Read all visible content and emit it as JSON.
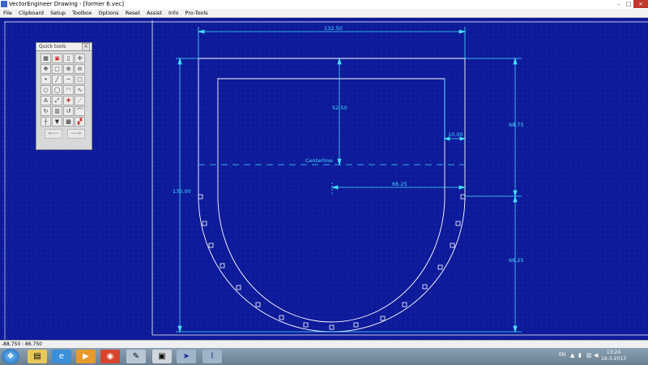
{
  "window": {
    "title": "VectorEngineer Drawing - [former 6.vec]",
    "min_label": "–",
    "max_label": "□",
    "close_label": "×"
  },
  "menu": [
    "File",
    "Clipboard",
    "Setup",
    "Toolbox",
    "Options",
    "Reset",
    "Assist",
    "Info",
    "Pro-Tools"
  ],
  "quick_tools": {
    "title": "Quick tools",
    "close_label": "×",
    "tools": [
      "grid-icon",
      "layers-icon",
      "new-page-icon",
      "snap-icon",
      "move-icon",
      "image-icon",
      "zoom-in-icon",
      "zoom-out-icon",
      "point-icon",
      "line-icon",
      "hline-icon",
      "rect-icon",
      "circle-icon",
      "ellipse-icon",
      "arc-icon",
      "curve-icon",
      "text-icon",
      "measure-icon",
      "trim-icon",
      "dimension-icon",
      "rotate-icon",
      "mirror-icon",
      "undo-icon",
      "fillet-icon",
      "vertical-icon",
      "fill-icon",
      "hatch-icon",
      "color-icon"
    ],
    "prev_label": "⟵",
    "next_label": "⟶"
  },
  "drawing": {
    "labels": {
      "width_top": "132.50",
      "depth_center": "52.50",
      "offset_right": "10.00",
      "height_upper": "68.75",
      "centerline": "Centerline",
      "radius": "66.25",
      "total_height": "135.00",
      "height_lower": "66.25"
    },
    "colors": {
      "line": "#ffffff",
      "dimension": "#44e0ff",
      "background": "#0d1a99"
    }
  },
  "statusbar": {
    "coords": "-88.750 : 86.750"
  },
  "taskbar": {
    "apps": [
      "windows-start-icon",
      "explorer-icon",
      "ie-icon",
      "media-player-icon",
      "chrome-icon",
      "paint-icon",
      "terminal-icon",
      "vectorengineer-icon",
      "other-app-icon"
    ],
    "lang": "EN",
    "time": "13:24",
    "date": "16-3-2013"
  }
}
